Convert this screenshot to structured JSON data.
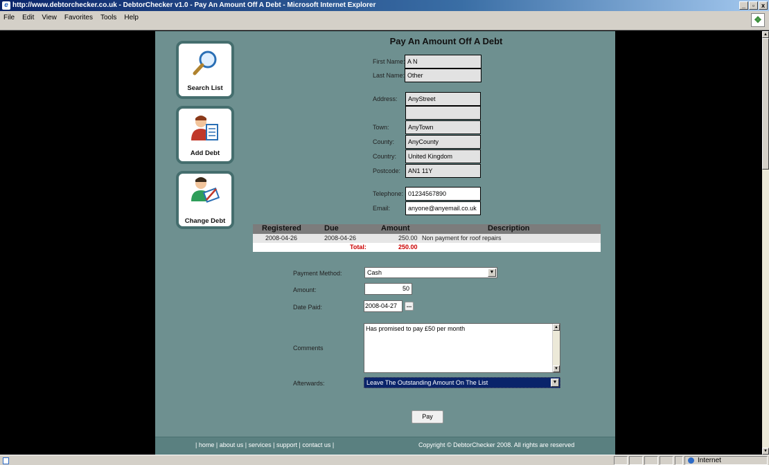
{
  "window": {
    "title": "http://www.debtorchecker.co.uk - DebtorChecker v1.0 - Pay An Amount Off A Debt - Microsoft Internet Explorer",
    "minimize": "_",
    "maximize": "▫",
    "close": "x"
  },
  "menu": [
    "File",
    "Edit",
    "View",
    "Favorites",
    "Tools",
    "Help"
  ],
  "nav": [
    {
      "label": "Search List",
      "icon": "magnifier-icon"
    },
    {
      "label": "Add Debt",
      "icon": "person-document-icon"
    },
    {
      "label": "Change Debt",
      "icon": "person-pen-icon"
    }
  ],
  "form": {
    "title": "Pay An Amount Off A Debt",
    "first_name_label": "First Name:",
    "first_name": "A N",
    "last_name_label": "Last Name:",
    "last_name": "Other",
    "address_label": "Address:",
    "address1": "AnyStreet",
    "address2": "",
    "town_label": "Town:",
    "town": "AnyTown",
    "county_label": "County:",
    "county": "AnyCounty",
    "country_label": "Country:",
    "country": "United Kingdom",
    "postcode_label": "Postcode:",
    "postcode": "AN1 11Y",
    "telephone_label": "Telephone:",
    "telephone": "01234567890",
    "email_label": "Email:",
    "email": "anyone@anyemail.co.uk"
  },
  "debts": {
    "headers": {
      "registered": "Registered",
      "due": "Due",
      "amount": "Amount",
      "description": "Description"
    },
    "rows": [
      {
        "registered": "2008-04-26",
        "due": "2008-04-26",
        "amount": "250.00",
        "description": "Non payment for roof repairs"
      }
    ],
    "total_label": "Total:",
    "total": "250.00"
  },
  "payment": {
    "method_label": "Payment Method:",
    "method": "Cash",
    "amount_label": "Amount:",
    "amount": "50",
    "date_label": "Date Paid:",
    "date": "2008-04-27",
    "date_picker": "...",
    "comments_label": "Comments",
    "comments": "Has promised to pay £50 per month",
    "afterwards_label": "Afterwards:",
    "afterwards": "Leave The Outstanding Amount On The List",
    "pay_button": "Pay"
  },
  "footer": {
    "sep_open": "|",
    "home": "home",
    "about": "about us",
    "services": "services",
    "support": "support",
    "contact": "contact us",
    "sep_close": "|",
    "copyright": "Copyright © DebtorChecker 2008. All rights are reserved"
  },
  "status": {
    "zone": "Internet"
  },
  "colors": {
    "page_bg": "#6e9090",
    "table_header": "#7c7c7c",
    "total_text": "#cc0000"
  }
}
